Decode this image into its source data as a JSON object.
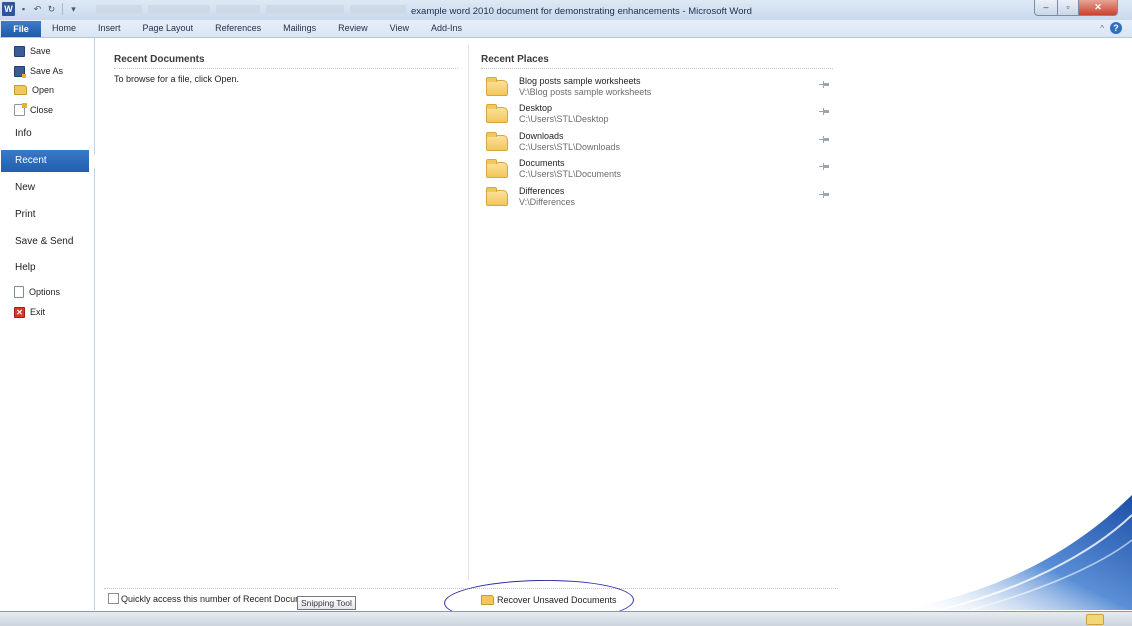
{
  "window": {
    "title": "example word 2010 document for demonstrating enhancements  -  Microsoft Word",
    "app_icon_letter": "W",
    "controls": {
      "minimize": "–",
      "maximize": "▫",
      "close": "✕"
    }
  },
  "ribbon": {
    "file_tab": "File",
    "tabs": [
      "Home",
      "Insert",
      "Page Layout",
      "References",
      "Mailings",
      "Review",
      "View",
      "Add-Ins"
    ],
    "help_glyph": "?",
    "minimize_glyph": "^"
  },
  "nav": {
    "save": "Save",
    "save_as": "Save As",
    "open": "Open",
    "close": "Close",
    "info": "Info",
    "recent": "Recent",
    "new": "New",
    "print": "Print",
    "save_send": "Save & Send",
    "help": "Help",
    "options": "Options",
    "exit": "Exit"
  },
  "recent_documents": {
    "title": "Recent Documents",
    "empty_text": "To browse for a file, click Open."
  },
  "recent_places": {
    "title": "Recent Places",
    "items": [
      {
        "name": "Blog posts sample worksheets",
        "path": "V:\\Blog posts sample worksheets"
      },
      {
        "name": "Desktop",
        "path": "C:\\Users\\STL\\Desktop"
      },
      {
        "name": "Downloads",
        "path": "C:\\Users\\STL\\Downloads"
      },
      {
        "name": "Documents",
        "path": "C:\\Users\\STL\\Documents"
      },
      {
        "name": "Differences",
        "path": "V:\\Differences"
      }
    ]
  },
  "footer": {
    "quick_access_label": "Quickly access this number of Recent Documen",
    "tooltip": "Snipping Tool",
    "recover_label": "Recover Unsaved Documents"
  },
  "icons": {
    "save": "save-icon",
    "save_as": "save-as-icon",
    "open": "open-folder-icon",
    "close": "close-document-icon",
    "options": "options-icon",
    "exit": "exit-icon",
    "folder": "folder-icon",
    "pin": "pin-icon"
  },
  "colors": {
    "accent": "#2a6ab9",
    "annotation": "#2b2fa8",
    "folder": "#f2c75b"
  }
}
